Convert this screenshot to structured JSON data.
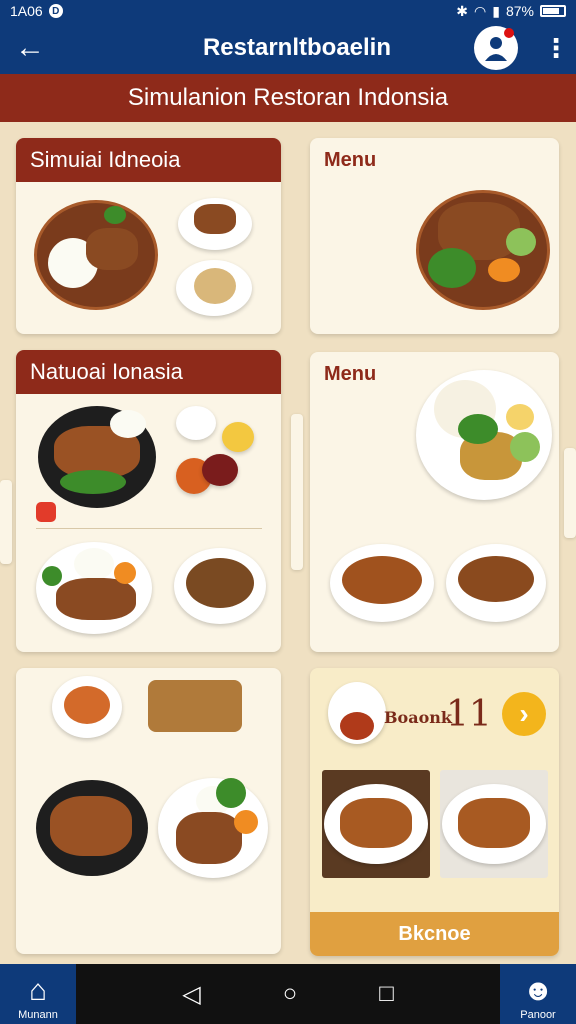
{
  "status": {
    "time": "1A06",
    "badge": "D",
    "battery": "87%"
  },
  "appbar": {
    "title": "Restarnltboaelin",
    "back_icon": "arrow-left-icon",
    "avatar_icon": "user-avatar-icon",
    "more_icon": "more-vertical-icon"
  },
  "banner": {
    "title": "Simulanion Restoran Indonsia"
  },
  "cards": {
    "c1": {
      "title": "Simuiai Idneoia"
    },
    "c2": {
      "title": "Menu"
    },
    "c3": {
      "title": "Natuoai Ionasia"
    },
    "c4": {
      "title": "Menu"
    },
    "c6": {
      "promo_label": "Boaonk",
      "promo_number": "11",
      "button": "Bkcnoe"
    }
  },
  "bottom_nav": {
    "home_label": "Munann",
    "profile_label": "Panoor"
  },
  "colors": {
    "primary": "#0e3a7a",
    "accent": "#8e2a1a",
    "yellow": "#f3b51c",
    "background": "#efe0c2"
  }
}
